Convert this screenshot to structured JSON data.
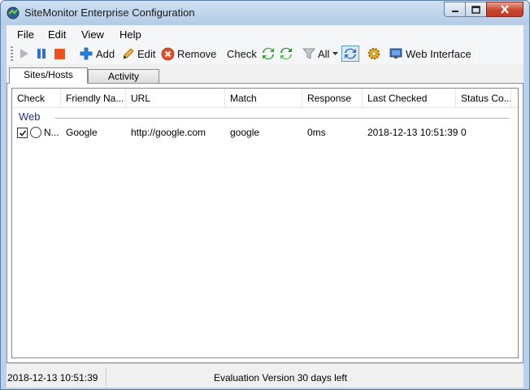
{
  "window": {
    "title": "SiteMonitor Enterprise Configuration"
  },
  "menu": {
    "items": [
      "File",
      "Edit",
      "View",
      "Help"
    ]
  },
  "toolbar": {
    "add_label": "Add",
    "edit_label": "Edit",
    "remove_label": "Remove",
    "check_label": "Check",
    "filter_label": "All",
    "web_label": "Web Interface"
  },
  "tabs": [
    "Sites/Hosts",
    "Activity"
  ],
  "list": {
    "columns": [
      "Check",
      "Friendly Na...",
      "URL",
      "Match",
      "Response",
      "Last Checked",
      "Status Co..."
    ],
    "group": "Web",
    "rows": [
      {
        "checked": true,
        "check_text": "N...",
        "name": "Google",
        "url": "http://google.com",
        "match": "google",
        "response": "0ms",
        "last_checked": "2018-12-13 10:51:39",
        "status": "0"
      }
    ]
  },
  "status": {
    "time": "2018-12-13 10:51:39",
    "message": "Evaluation Version 30 days left"
  }
}
